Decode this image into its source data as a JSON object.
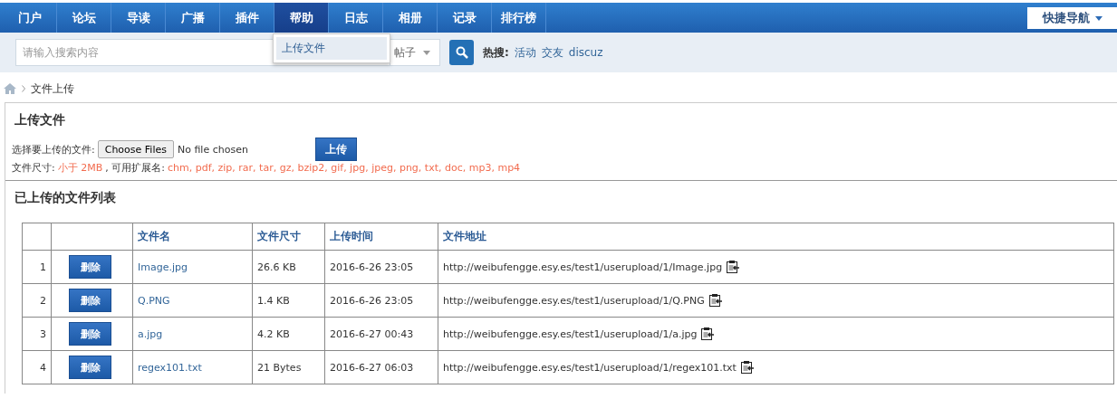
{
  "nav": {
    "items": [
      {
        "label": "门户",
        "selected": false
      },
      {
        "label": "论坛",
        "selected": false
      },
      {
        "label": "导读",
        "selected": false
      },
      {
        "label": "广播",
        "selected": false
      },
      {
        "label": "插件",
        "selected": false
      },
      {
        "label": "帮助",
        "selected": true
      },
      {
        "label": "日志",
        "selected": false
      },
      {
        "label": "相册",
        "selected": false
      },
      {
        "label": "记录",
        "selected": false
      },
      {
        "label": "排行榜",
        "selected": false
      }
    ],
    "quick_nav": "快捷导航",
    "dropdown": {
      "items": [
        "上传文件"
      ]
    }
  },
  "search": {
    "placeholder": "请输入搜索内容",
    "type": "帖子",
    "hot_label": "热搜:",
    "hot": [
      "活动",
      "交友",
      "discuz"
    ]
  },
  "breadcrumb": [
    "文件上传"
  ],
  "upload": {
    "title": "上传文件",
    "choose_label": "选择要上传的文件:",
    "choose_button": "Choose Files",
    "no_file": "No file chosen",
    "submit": "上传",
    "limit_label": "文件尺寸:",
    "limit": "小于 2MB",
    "ext_label": ", 可用扩展名:",
    "extensions": "chm, pdf, zip, rar, tar, gz, bzip2, gif, jpg, jpeg, png, txt, doc, mp3, mp4"
  },
  "list": {
    "title": "已上传的文件列表",
    "columns": [
      "文件名",
      "文件尺寸",
      "上传时间",
      "文件地址"
    ],
    "rows": [
      {
        "index": "1",
        "delete_label": "删除",
        "name": "Image.jpg",
        "size": "26.6 KB",
        "time": "2016-6-26 23:05",
        "url": "http://weibufengge.esy.es/test1/userupload/1/Image.jpg"
      },
      {
        "index": "2",
        "delete_label": "删除",
        "name": "Q.PNG",
        "size": "1.4 KB",
        "time": "2016-6-26 23:05",
        "url": "http://weibufengge.esy.es/test1/userupload/1/Q.PNG"
      },
      {
        "index": "3",
        "delete_label": "删除",
        "name": "a.jpg",
        "size": "4.2 KB",
        "time": "2016-6-27 00:43",
        "url": "http://weibufengge.esy.es/test1/userupload/1/a.jpg"
      },
      {
        "index": "4",
        "delete_label": "删除",
        "name": "regex101.txt",
        "size": "21 Bytes",
        "time": "2016-6-27 06:03",
        "url": "http://weibufengge.esy.es/test1/userupload/1/regex101.txt"
      }
    ]
  }
}
